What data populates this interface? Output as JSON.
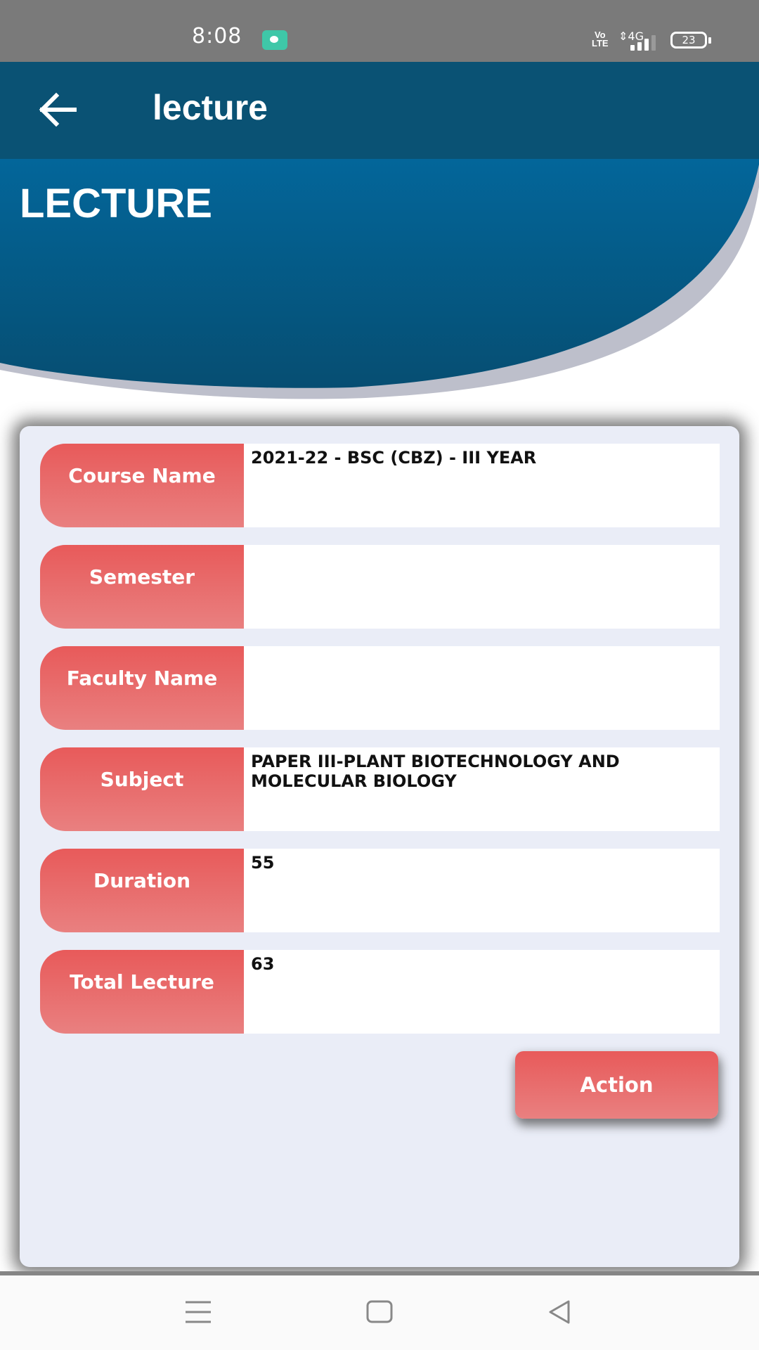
{
  "status_bar": {
    "time": "8:08",
    "notification_icon": "app-notification-icon",
    "volte_label_top": "Vo",
    "volte_label_bottom": "LTE",
    "network_type": "4G",
    "battery_level": "23"
  },
  "app_bar": {
    "back_icon": "arrow-left-icon",
    "title": "lecture"
  },
  "hero": {
    "title": "LECTURE"
  },
  "form": {
    "rows": [
      {
        "label": "Course Name",
        "value": "2021-22 - BSC (CBZ) - III YEAR"
      },
      {
        "label": "Semester",
        "value": ""
      },
      {
        "label": "Faculty Name",
        "value": ""
      },
      {
        "label": "Subject",
        "value": "PAPER III-PLANT BIOTECHNOLOGY AND MOLECULAR BIOLOGY"
      },
      {
        "label": "Duration",
        "value": "55"
      },
      {
        "label": "Total Lecture",
        "value": "63"
      }
    ],
    "action_label": "Action"
  },
  "nav_bar": {
    "menu_icon": "menu-icon",
    "home_icon": "home-icon",
    "back_icon": "back-triangle-icon"
  },
  "colors": {
    "app_bar": "#0a5274",
    "hero_blue": "#05628f",
    "label_red": "#e85a5a",
    "card_bg": "#eaedf7"
  }
}
